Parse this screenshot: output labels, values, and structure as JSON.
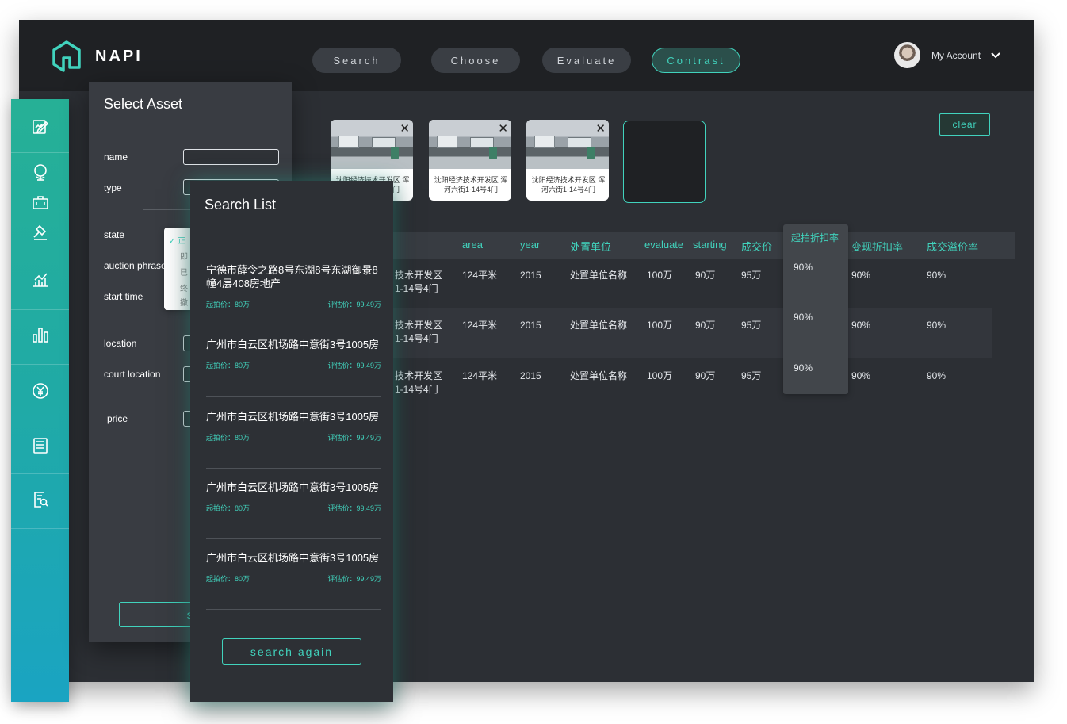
{
  "brand": {
    "name": "NAPI"
  },
  "nav": [
    {
      "label": "Search"
    },
    {
      "label": "Choose"
    },
    {
      "label": "Evaluate"
    },
    {
      "label": "Contrast"
    }
  ],
  "account": {
    "label": "My Account"
  },
  "thumbnails": [
    {
      "caption": "沈阳经济技术开发区 浑河六街1-14号4门"
    },
    {
      "caption": "沈阳经济技术开发区 浑河六街1-14号4门"
    },
    {
      "caption": "沈阳经济技术开发区 浑河六街1-14号4门"
    }
  ],
  "clear_label": "clear",
  "table": {
    "headers": [
      "area",
      "year",
      "处置单位",
      "evaluate",
      "starting",
      "成交价",
      "起拍折扣率",
      "变现折扣率",
      "成交溢价率"
    ],
    "rows": [
      {
        "addr1": "技术开发区",
        "addr2": "1-14号4门",
        "area": "124平米",
        "year": "2015",
        "unit": "处置单位名称",
        "evaluate": "100万",
        "starting": "90万",
        "deal": "95万",
        "start_discount": "90%",
        "realize_discount": "90%",
        "premium": "90%"
      },
      {
        "addr1": "技术开发区",
        "addr2": "1-14号4门",
        "area": "124平米",
        "year": "2015",
        "unit": "处置单位名称",
        "evaluate": "100万",
        "starting": "90万",
        "deal": "95万",
        "start_discount": "90%",
        "realize_discount": "90%",
        "premium": "90%"
      },
      {
        "addr1": "技术开发区",
        "addr2": "1-14号4门",
        "area": "124平米",
        "year": "2015",
        "unit": "处置单位名称",
        "evaluate": "100万",
        "starting": "90万",
        "deal": "95万",
        "start_discount": "90%",
        "realize_discount": "90%",
        "premium": "90%"
      }
    ]
  },
  "sidebar": {
    "icons": [
      "edit-icon",
      "globe-icon",
      "briefcase-icon",
      "gavel-icon",
      "line-chart-icon",
      "bar-chart-icon",
      "yen-icon",
      "news-icon",
      "search-document-icon"
    ]
  },
  "asset_panel": {
    "title": "Select Asset",
    "fields": {
      "name": "name",
      "type": "type",
      "state": "state",
      "auction_phrase": "auction phrase",
      "start_time": "start time",
      "location": "location",
      "court_location": "court location",
      "price": "price"
    },
    "state_options": [
      "正",
      "即",
      "已",
      "终",
      "撤"
    ],
    "search_label": "sea"
  },
  "search_list": {
    "title": "Search List",
    "items": [
      {
        "address": "宁德市薛令之路8号东湖8号东湖御景8幢4层408房地产",
        "start_price": "起拍价：80万",
        "eval_price": "评估价：99.49万"
      },
      {
        "address": "广州市白云区机场路中意街3号1005房",
        "start_price": "起拍价：80万",
        "eval_price": "评估价：99.49万"
      },
      {
        "address": "广州市白云区机场路中意街3号1005房",
        "start_price": "起拍价：80万",
        "eval_price": "评估价：99.49万"
      },
      {
        "address": "广州市白云区机场路中意街3号1005房",
        "start_price": "起拍价：80万",
        "eval_price": "评估价：99.49万"
      },
      {
        "address": "广州市白云区机场路中意街3号1005房",
        "start_price": "起拍价：80万",
        "eval_price": "评估价：99.49万"
      }
    ],
    "search_again_label": "search again"
  }
}
